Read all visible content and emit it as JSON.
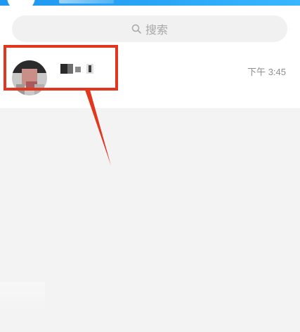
{
  "search": {
    "label": "搜索",
    "icon": "search-icon"
  },
  "chats": [
    {
      "name": "",
      "time": "下午 3:45",
      "preview": ""
    }
  ],
  "annotation": {
    "color": "#e2361f",
    "target": "chat-row"
  },
  "colors": {
    "accent": "#1e98f0",
    "background": "#f3f3f3",
    "search_bg": "#f1f1f1"
  }
}
